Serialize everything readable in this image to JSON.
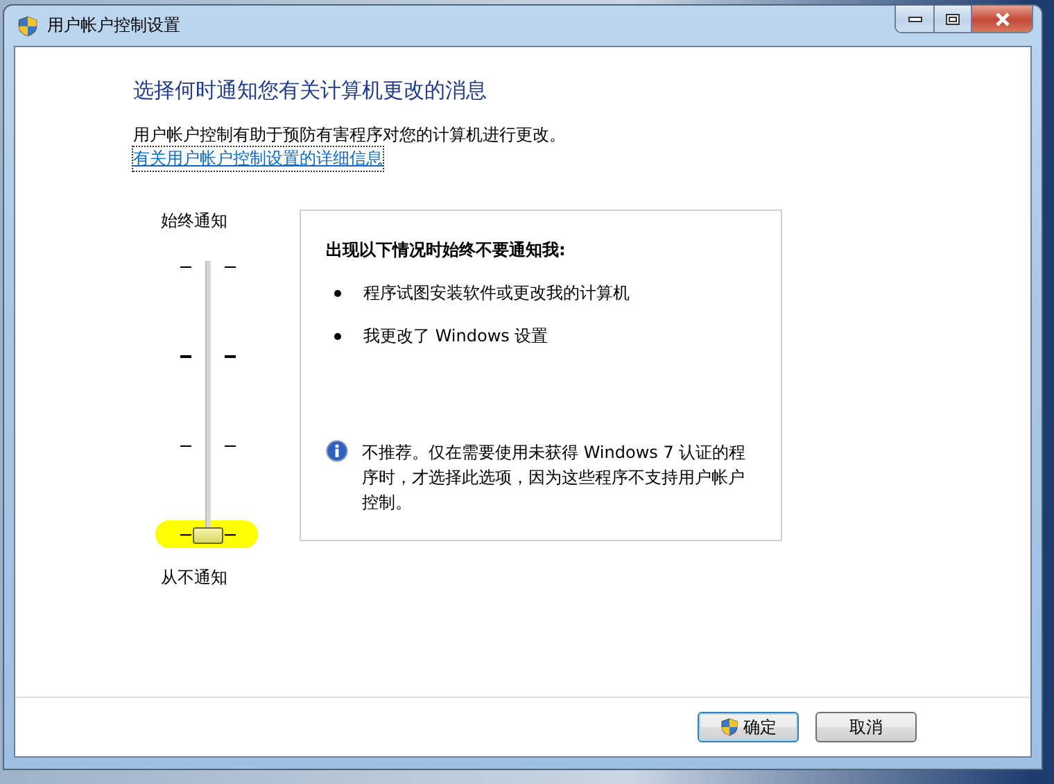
{
  "window": {
    "title": "用户帐户控制设置"
  },
  "heading": "选择何时通知您有关计算机更改的消息",
  "description": "用户帐户控制有助于预防有害程序对您的计算机进行更改。",
  "link": "有关用户帐户控制设置的详细信息",
  "slider": {
    "top_label": "始终通知",
    "bottom_label": "从不通知",
    "level": 0,
    "highlighted": true
  },
  "info_panel": {
    "title": "出现以下情况时始终不要通知我:",
    "bullets": [
      "程序试图安装软件或更改我的计算机",
      "我更改了 Windows 设置"
    ],
    "note": "不推荐。仅在需要使用未获得 Windows 7 认证的程序时，才选择此选项，因为这些程序不支持用户帐户控制。"
  },
  "buttons": [
    {
      "label": "确定",
      "kind": "shield"
    },
    {
      "label": "取消",
      "kind": "plain"
    }
  ]
}
